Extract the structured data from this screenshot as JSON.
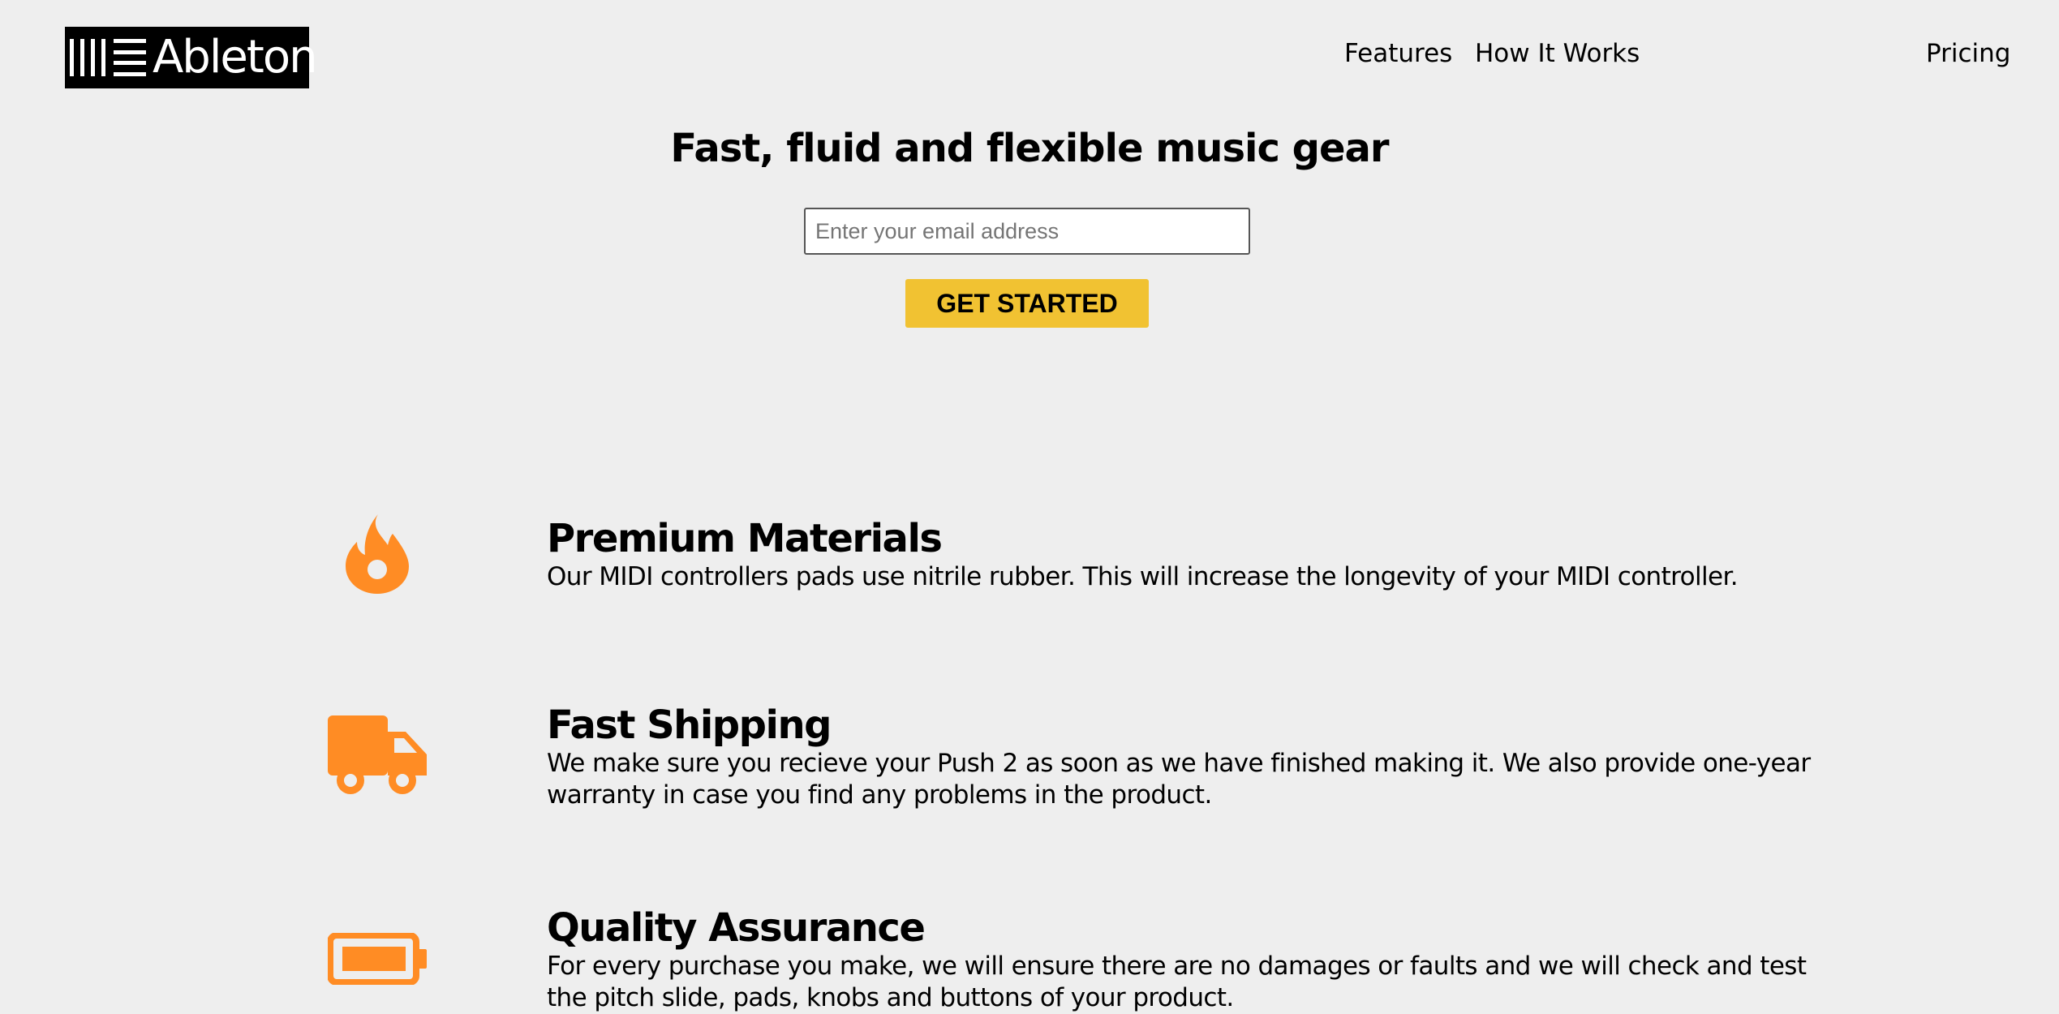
{
  "header": {
    "logo_text": "Ableton",
    "nav": [
      {
        "label": "Features"
      },
      {
        "label": "How It Works"
      },
      {
        "label": "Pricing"
      }
    ]
  },
  "hero": {
    "title": "Fast, fluid and flexible music gear",
    "email_placeholder": "Enter your email address",
    "email_value": "",
    "cta_label": "GET STARTED"
  },
  "features": [
    {
      "icon": "fire-icon",
      "title": "Premium Materials",
      "text": "Our MIDI controllers pads use nitrile rubber. This will increase the longevity of your MIDI controller."
    },
    {
      "icon": "truck-icon",
      "title": "Fast Shipping",
      "text": "We make sure you recieve your Push 2 as soon as we have finished making it. We also provide one-year warranty in case you find any problems in the product."
    },
    {
      "icon": "battery-icon",
      "title": "Quality Assurance",
      "text": "For every purchase you make, we will ensure there are no damages or faults and we will check and test the pitch slide, pads, knobs and buttons of your product."
    }
  ],
  "colors": {
    "background": "#eeeeee",
    "accent_button": "#f1c232",
    "icon_orange": "#ff8c24",
    "logo_bg": "#000000"
  }
}
